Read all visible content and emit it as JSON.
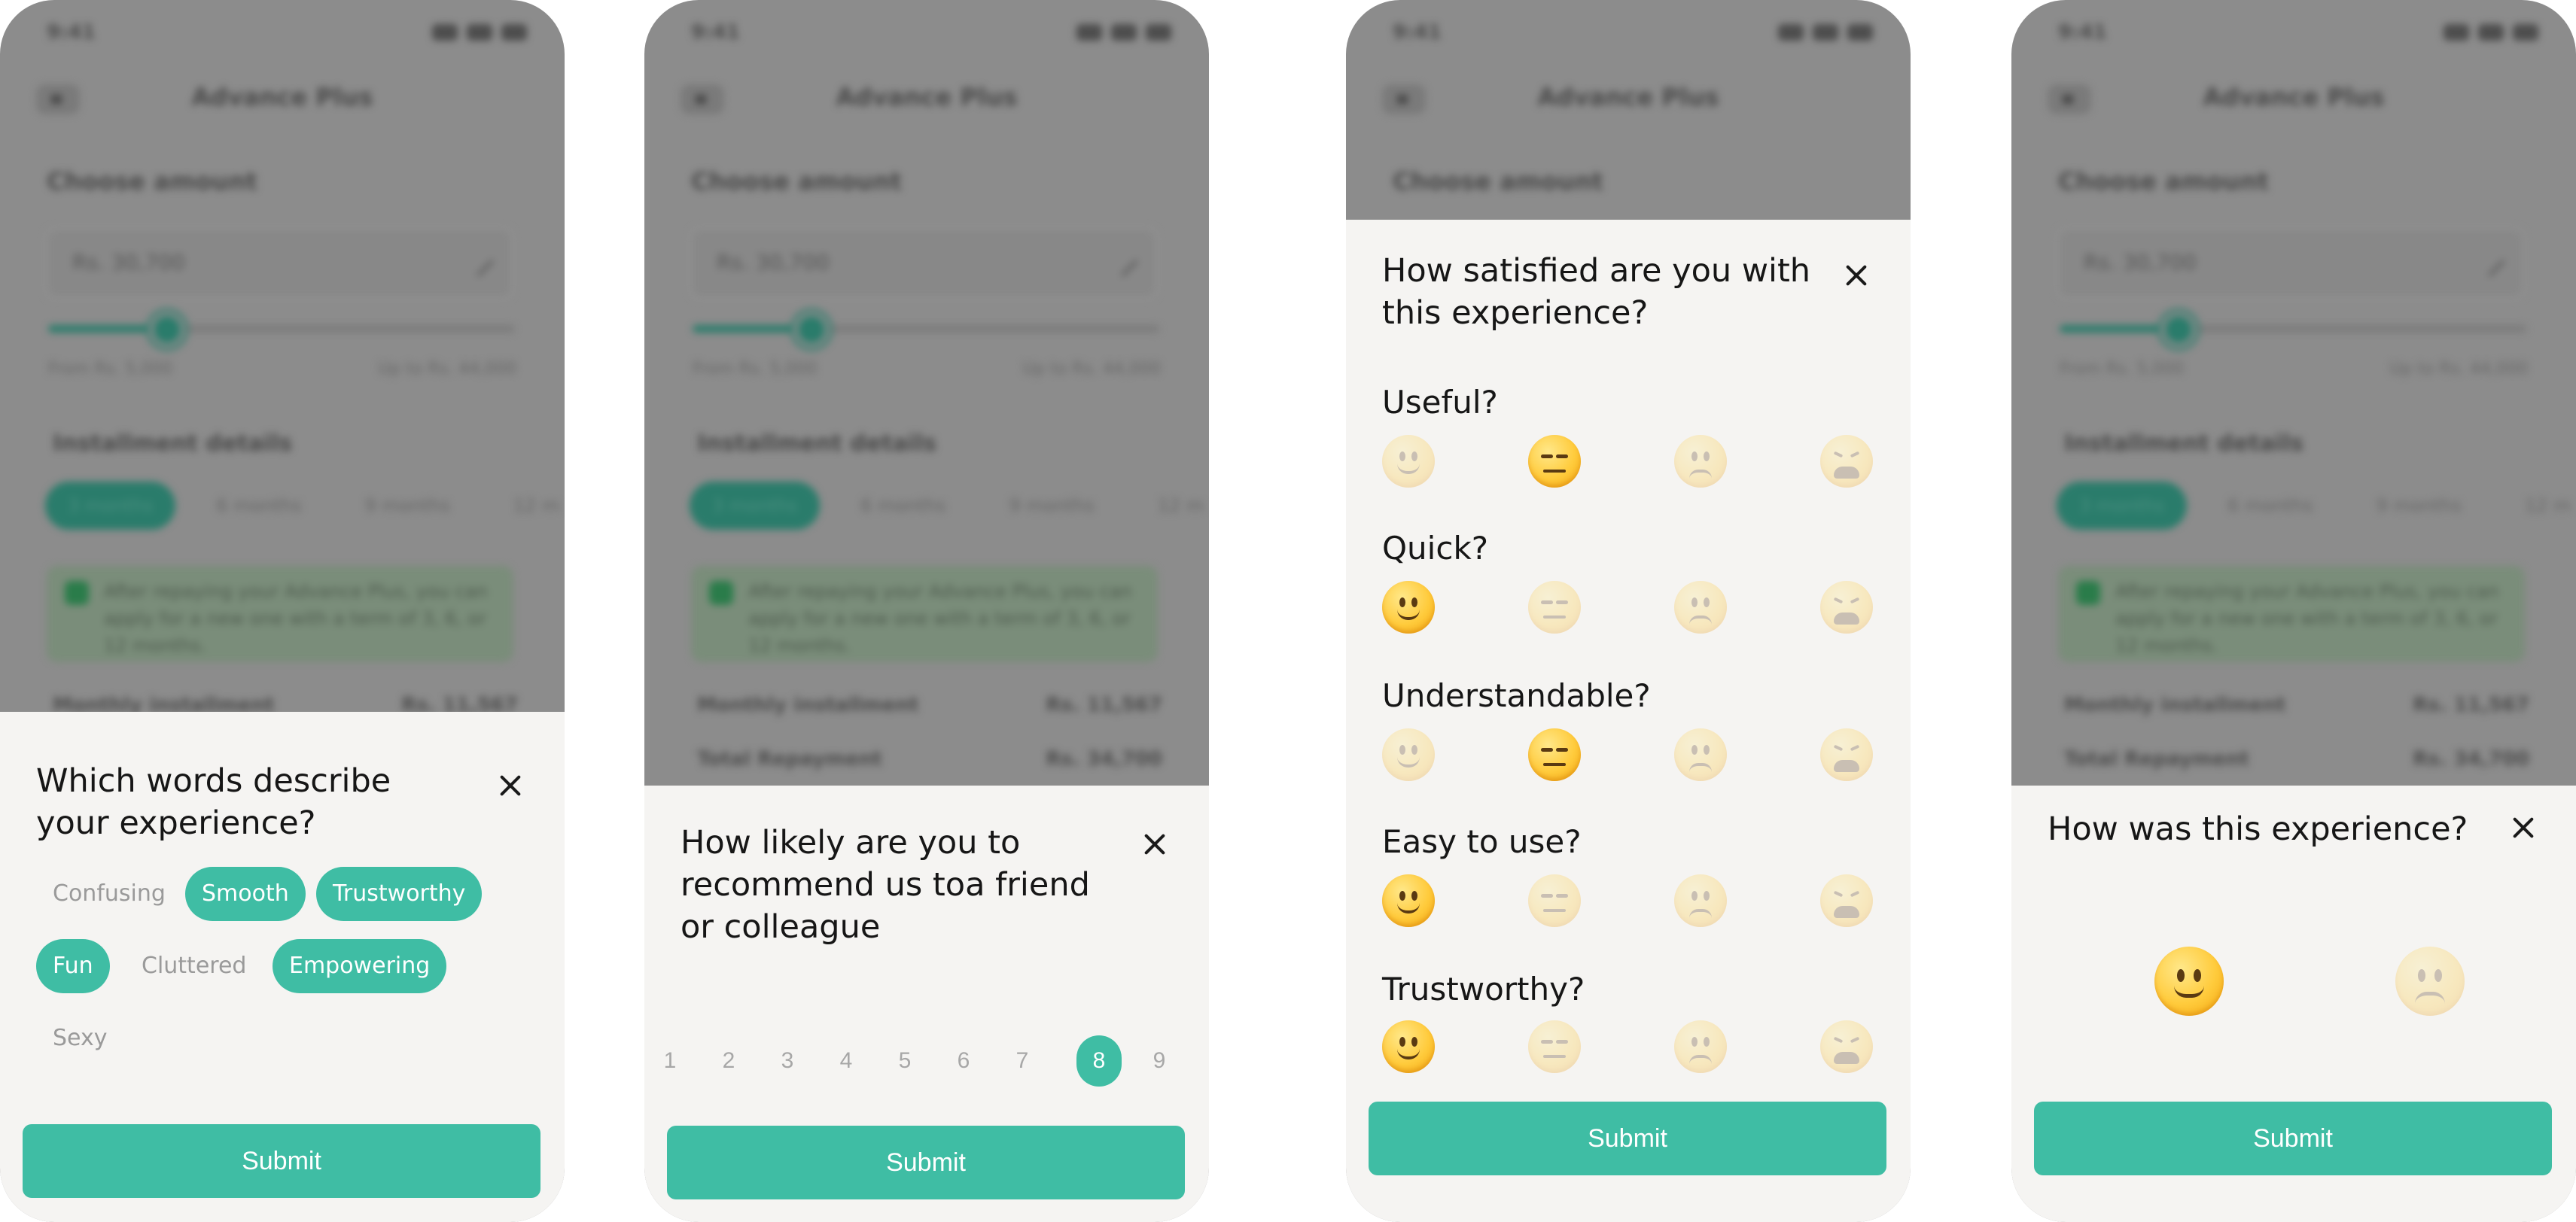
{
  "background_app": {
    "time": "9:41",
    "title": "Advance Plus",
    "choose_amount": "Choose amount",
    "amount_value": "Rs. 30,700",
    "slider_min_label": "From Rs. 5,000",
    "slider_max_label": "Up to Rs. 44,000",
    "installment_heading": "Installment details",
    "tenure_chips": [
      "3 months",
      "6 months",
      "9 months",
      "12 m"
    ],
    "note": "After repaying your Advance Plus, you can apply for a new one with a term of 3, 6, or 12 months.",
    "monthly_installment_label": "Monthly installment",
    "monthly_installment_value": "Rs. 11,567",
    "total_repayment_label": "Total Repayment",
    "total_repayment_value": "Rs. 34,700"
  },
  "screen1": {
    "title": "Which words describe your experience?",
    "words": [
      {
        "label": "Confusing",
        "selected": false
      },
      {
        "label": "Smooth",
        "selected": true
      },
      {
        "label": "Trustworthy",
        "selected": true
      },
      {
        "label": "Fun",
        "selected": true
      },
      {
        "label": "Cluttered",
        "selected": false
      },
      {
        "label": "Empowering",
        "selected": true
      },
      {
        "label": "Sexy",
        "selected": false
      }
    ],
    "submit_label": "Submit"
  },
  "screen2": {
    "title": "How likely are you to recommend us toa friend or colleague",
    "scale": [
      "1",
      "2",
      "3",
      "4",
      "5",
      "6",
      "7",
      "8",
      "9"
    ],
    "selected": "8",
    "submit_label": "Submit"
  },
  "screen3": {
    "title": "How satisfied are you with this experience?",
    "questions": [
      {
        "label": "Useful?",
        "selected": "neutral"
      },
      {
        "label": "Quick?",
        "selected": "happy"
      },
      {
        "label": "Understandable?",
        "selected": "neutral"
      },
      {
        "label": "Easy to use?",
        "selected": "happy"
      },
      {
        "label": "Trustworthy?",
        "selected": "happy"
      }
    ],
    "scale_icons": [
      "slightly-smiling-face-icon",
      "expressionless-face-icon",
      "frowning-face-icon",
      "tired-face-icon"
    ],
    "submit_label": "Submit"
  },
  "screen4": {
    "title": "How was this experience?",
    "options": [
      "happy-face-icon",
      "frowning-face-icon"
    ],
    "selected": "happy",
    "submit_label": "Submit"
  },
  "colors": {
    "accent": "#3fbda4",
    "sheet_background": "#f5f4f2",
    "unselected_text": "#9a9a9a"
  }
}
